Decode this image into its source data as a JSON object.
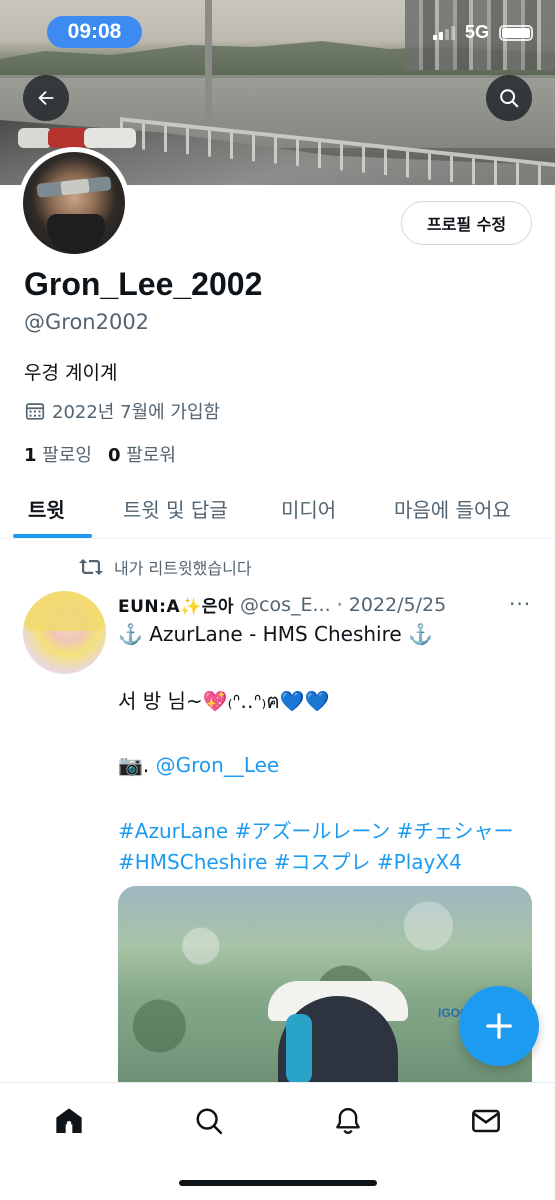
{
  "status_bar": {
    "time": "09:08",
    "network": "5G"
  },
  "profile": {
    "edit_button": "프로필 수정",
    "display_name": "Gron_Lee_2002",
    "handle": "@Gron2002",
    "bio": "우경 계이계",
    "joined": "2022년 7월에 가입함",
    "following_count": "1",
    "following_label": "팔로잉",
    "followers_count": "0",
    "followers_label": "팔로워"
  },
  "tabs": [
    {
      "label": "트윗",
      "active": true
    },
    {
      "label": "트윗 및 답글",
      "active": false
    },
    {
      "label": "미디어",
      "active": false
    },
    {
      "label": "마음에 들어요",
      "active": false
    }
  ],
  "tweet": {
    "retweet_context": "내가 리트윗했습니다",
    "author_name": "EUN:A✨은아",
    "author_handle_date": "@cos_E... · 2022/5/25",
    "more": "···",
    "lines": {
      "title": "⚓️ AzurLane - HMS Cheshire ⚓️",
      "greeting": "서 방 님~💖₍ᐢ‥ᐢ₎ฅ💙💙",
      "camera_prefix": "📷.",
      "camera_mention": "@Gron__Lee",
      "hashtags_1": "#AzurLane #アズールレーン #チェシャー",
      "hashtags_2": "#HMSCheshire #コスプレ #PlayX4"
    },
    "media_watermark": "IGOON"
  },
  "colors": {
    "accent": "#1d9bf0",
    "text": "#0f1419",
    "secondary": "#536471",
    "status_pill": "#3d8bf0"
  },
  "icons": {
    "back": "arrow-left-icon",
    "search": "search-icon",
    "calendar": "calendar-icon",
    "retweet": "retweet-icon",
    "compose": "plus-icon",
    "nav": [
      "home-icon",
      "search-icon",
      "bell-icon",
      "mail-icon"
    ]
  }
}
